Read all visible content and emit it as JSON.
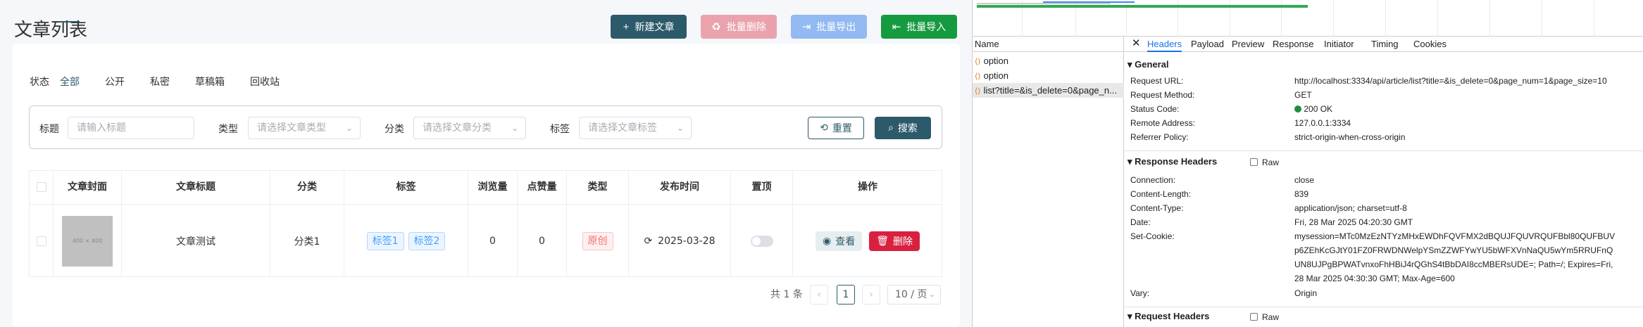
{
  "page": {
    "title": "文章列表",
    "buttons": {
      "new": {
        "label": "新建文章",
        "color": "#2d5a6b"
      },
      "batch_delete": {
        "label": "批量删除",
        "color": "#eaa3ad"
      },
      "batch_export": {
        "label": "批量导出",
        "color": "#92b9f2"
      },
      "batch_import": {
        "label": "批量导入",
        "color": "#169a3f"
      }
    },
    "status_label": "状态",
    "tabs": [
      "全部",
      "公开",
      "私密",
      "草稿箱",
      "回收站"
    ],
    "filters": {
      "title_label": "标题",
      "title_placeholder": "请输入标题",
      "type_label": "类型",
      "type_placeholder": "请选择文章类型",
      "category_label": "分类",
      "category_placeholder": "请选择文章分类",
      "tag_label": "标签",
      "tag_placeholder": "请选择文章标签",
      "reset_label": "重置",
      "search_label": "搜索"
    },
    "table": {
      "columns": [
        "文章封面",
        "文章标题",
        "分类",
        "标签",
        "浏览量",
        "点赞量",
        "类型",
        "发布时间",
        "置顶",
        "操作"
      ],
      "rows": [
        {
          "cover_text": "400 × 400",
          "title": "文章测试",
          "category": "分类1",
          "tags": [
            "标签1",
            "标签2"
          ],
          "views": "0",
          "likes": "0",
          "type": "原创",
          "publish_time": "2025-03-28",
          "view_label": "查看",
          "delete_label": "删除"
        }
      ]
    },
    "pagination": {
      "total": "共 1 条",
      "current": "1",
      "page_size": "10 / 页"
    }
  },
  "devtools": {
    "name_header": "Name",
    "requests": [
      "option",
      "option",
      "list?title=&is_delete=0&page_n..."
    ],
    "tabs": [
      "Headers",
      "Payload",
      "Preview",
      "Response",
      "Initiator",
      "Timing",
      "Cookies"
    ],
    "general": {
      "heading": "General",
      "items": [
        {
          "k": "Request URL:",
          "v": "http://localhost:3334/api/article/list?title=&is_delete=0&page_num=1&page_size=10"
        },
        {
          "k": "Request Method:",
          "v": "GET"
        },
        {
          "k": "Status Code:",
          "v": "200 OK"
        },
        {
          "k": "Remote Address:",
          "v": "127.0.0.1:3334"
        },
        {
          "k": "Referrer Policy:",
          "v": "strict-origin-when-cross-origin"
        }
      ]
    },
    "response_headers": {
      "heading": "Response Headers",
      "raw_label": "Raw",
      "items": [
        {
          "k": "Connection:",
          "v": "close"
        },
        {
          "k": "Content-Length:",
          "v": "839"
        },
        {
          "k": "Content-Type:",
          "v": "application/json; charset=utf-8"
        },
        {
          "k": "Date:",
          "v": "Fri, 28 Mar 2025 04:20:30 GMT"
        },
        {
          "k": "Set-Cookie:",
          "lines": [
            "mysession=MTc0MzEzNTYzMHxEWDhFQVFMX2dBQUJFQUVRQUFBbl80QUFBUV",
            "p6ZEhKcGJtY01FZ0FRWDNWelpYSmZZWFYwYU5bWFXVnNaQU5wYm5RRUFnQ",
            "UN8UJPgBPWATvnxoFhHBiJ4rQGhS4tBbDAI8ccMBERsUDE=; Path=/; Expires=Fri,",
            "28 Mar 2025 04:30:30 GMT; Max-Age=600"
          ]
        },
        {
          "k": "Vary:",
          "v": "Origin"
        }
      ]
    },
    "request_headers": {
      "heading": "Request Headers",
      "raw_label": "Raw"
    }
  }
}
